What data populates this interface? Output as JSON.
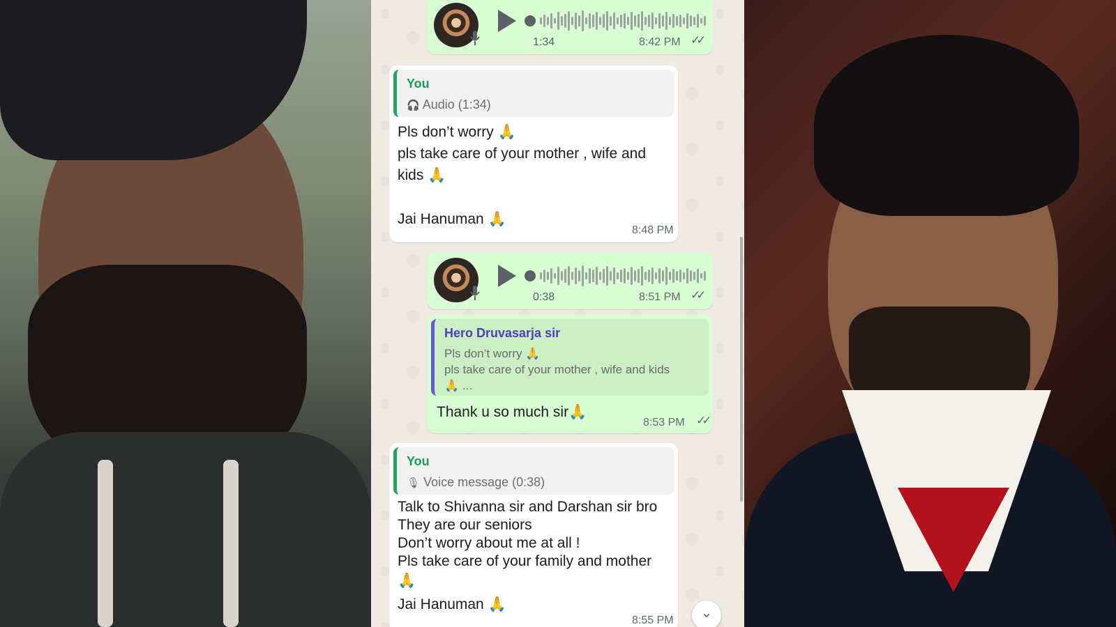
{
  "chat": {
    "audio1": {
      "duration": "1:34",
      "time": "8:42 PM",
      "status_icon": "double-check-icon"
    },
    "msg1": {
      "quote_author": "You",
      "quote_icon": "headphones-icon",
      "quote_text": "Audio (1:34)",
      "lines": [
        "Pls don’t worry 🙏",
        "pls take care of your  mother , wife and",
        "kids 🙏",
        "Jai Hanuman 🙏"
      ],
      "time": "8:48 PM"
    },
    "audio2": {
      "duration": "0:38",
      "time": "8:51 PM",
      "status_icon": "double-check-icon"
    },
    "msg2": {
      "quote_author": "Hero Druvasarja sir",
      "quote_lines": [
        "Pls don’t worry 🙏",
        "pls take care of your  mother , wife and kids",
        "🙏 ..."
      ],
      "text": "Thank u so much sir🙏",
      "time": "8:53 PM"
    },
    "msg3": {
      "quote_author": "You",
      "quote_icon": "mic-icon",
      "quote_text": "Voice message (0:38)",
      "lines": [
        "Talk to Shivanna sir and Darshan sir bro",
        "They are our seniors",
        "Don’t worry about me at all !",
        "Pls take care of your family and mother",
        "🙏",
        "Jai Hanuman 🙏"
      ],
      "time": "8:55 PM"
    },
    "scroll_down_icon": "double-chevron-down-icon"
  }
}
